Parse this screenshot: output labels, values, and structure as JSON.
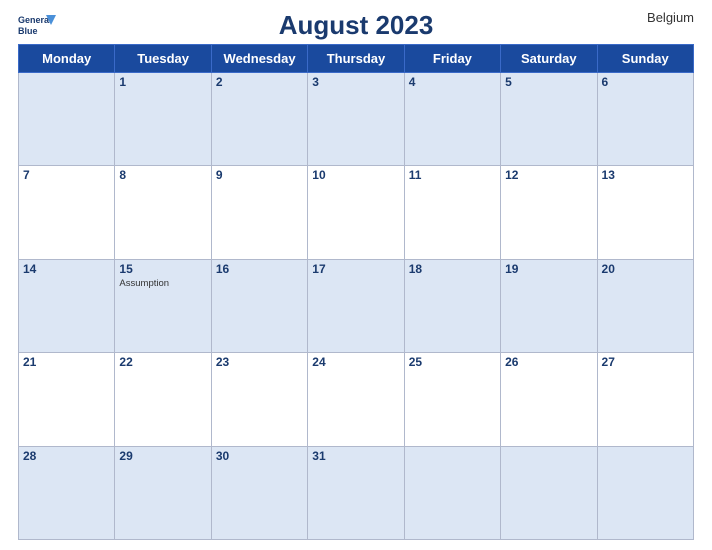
{
  "header": {
    "title": "August 2023",
    "country": "Belgium",
    "logo_line1": "General",
    "logo_line2": "Blue"
  },
  "weekdays": [
    "Monday",
    "Tuesday",
    "Wednesday",
    "Thursday",
    "Friday",
    "Saturday",
    "Sunday"
  ],
  "rows": [
    [
      {
        "date": "",
        "holiday": ""
      },
      {
        "date": "1",
        "holiday": ""
      },
      {
        "date": "2",
        "holiday": ""
      },
      {
        "date": "3",
        "holiday": ""
      },
      {
        "date": "4",
        "holiday": ""
      },
      {
        "date": "5",
        "holiday": ""
      },
      {
        "date": "6",
        "holiday": ""
      }
    ],
    [
      {
        "date": "7",
        "holiday": ""
      },
      {
        "date": "8",
        "holiday": ""
      },
      {
        "date": "9",
        "holiday": ""
      },
      {
        "date": "10",
        "holiday": ""
      },
      {
        "date": "11",
        "holiday": ""
      },
      {
        "date": "12",
        "holiday": ""
      },
      {
        "date": "13",
        "holiday": ""
      }
    ],
    [
      {
        "date": "14",
        "holiday": ""
      },
      {
        "date": "15",
        "holiday": "Assumption"
      },
      {
        "date": "16",
        "holiday": ""
      },
      {
        "date": "17",
        "holiday": ""
      },
      {
        "date": "18",
        "holiday": ""
      },
      {
        "date": "19",
        "holiday": ""
      },
      {
        "date": "20",
        "holiday": ""
      }
    ],
    [
      {
        "date": "21",
        "holiday": ""
      },
      {
        "date": "22",
        "holiday": ""
      },
      {
        "date": "23",
        "holiday": ""
      },
      {
        "date": "24",
        "holiday": ""
      },
      {
        "date": "25",
        "holiday": ""
      },
      {
        "date": "26",
        "holiday": ""
      },
      {
        "date": "27",
        "holiday": ""
      }
    ],
    [
      {
        "date": "28",
        "holiday": ""
      },
      {
        "date": "29",
        "holiday": ""
      },
      {
        "date": "30",
        "holiday": ""
      },
      {
        "date": "31",
        "holiday": ""
      },
      {
        "date": "",
        "holiday": ""
      },
      {
        "date": "",
        "holiday": ""
      },
      {
        "date": "",
        "holiday": ""
      }
    ]
  ],
  "row_classes": [
    "row-shaded",
    "row-white",
    "row-shaded",
    "row-white",
    "row-shaded"
  ]
}
